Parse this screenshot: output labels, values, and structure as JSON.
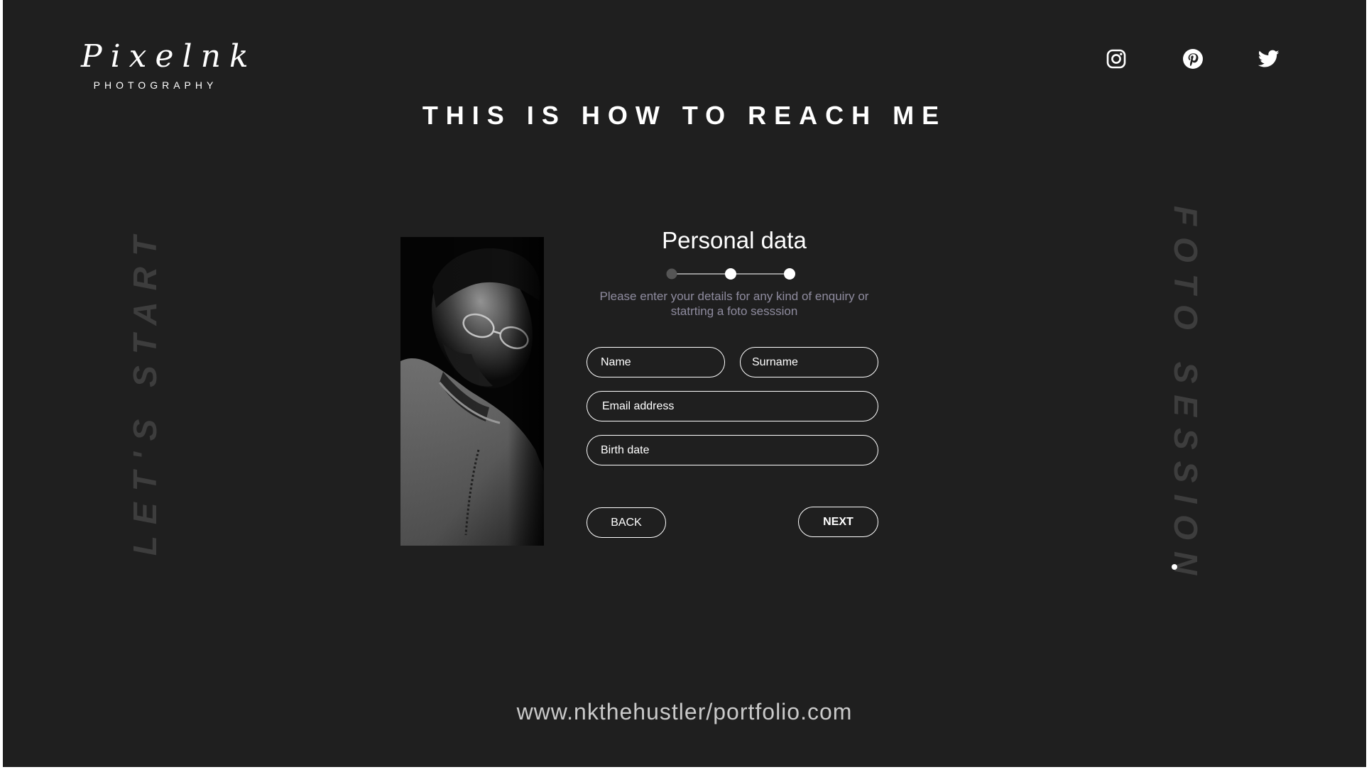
{
  "brand": {
    "logo_script": "Pixelnk",
    "logo_subtitle": "PHOTOGRAPHY"
  },
  "social": [
    {
      "icon": "instagram-icon"
    },
    {
      "icon": "pinterest-icon"
    },
    {
      "icon": "twitter-icon"
    }
  ],
  "page": {
    "heading": "THIS IS HOW TO REACH ME",
    "side_left": "LET'S START",
    "side_right": "FOTO SESSION"
  },
  "form": {
    "title": "Personal data",
    "description": "Please enter your details for any kind of enquiry or statrting a foto sesssion",
    "stepper": {
      "total_steps": 3,
      "completed_steps": [
        2,
        3
      ]
    },
    "fields": {
      "name_placeholder": "Name",
      "surname_placeholder": "Surname",
      "email_placeholder": "Email address",
      "birth_placeholder": "Birth date"
    },
    "buttons": {
      "back_label": "BACK",
      "next_label": "NEXT"
    }
  },
  "footer": {
    "url": "www.nkthehustler/portfolio.com"
  },
  "colors": {
    "background": "#1f1f1f",
    "text": "#ffffff",
    "muted_text": "#8e8b9e",
    "watermark_text": "#3d3d3d",
    "inactive_step": "#555555"
  }
}
